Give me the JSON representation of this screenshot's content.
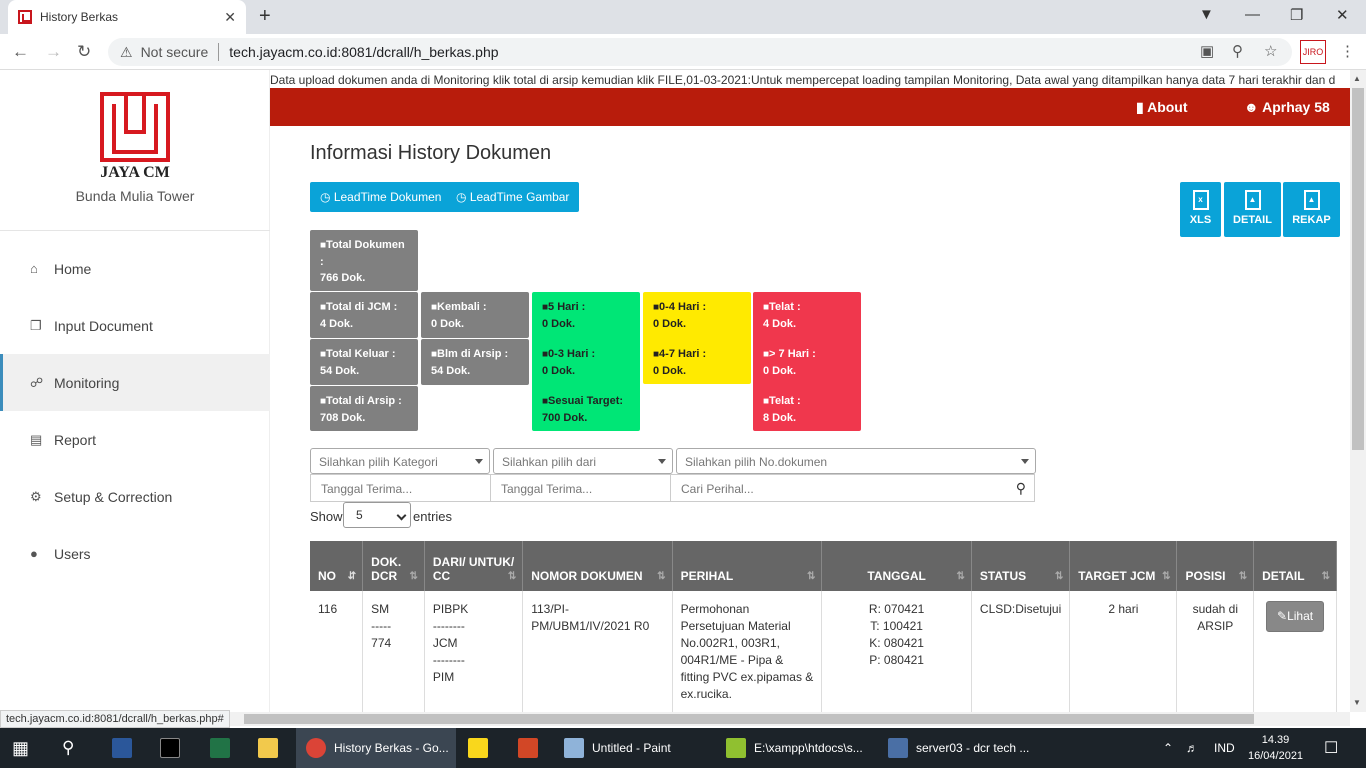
{
  "browser": {
    "tab_title": "History Berkas",
    "tab_close": "✕",
    "new_tab": "+",
    "not_secure": "Not secure",
    "url": "tech.jayacm.co.id:8081/dcrall/h_berkas.php",
    "status_url": "tech.jayacm.co.id:8081/dcrall/h_berkas.php#"
  },
  "sidebar": {
    "logo_text": "JAYA CM",
    "tower": "Bunda Mulia Tower",
    "items": [
      {
        "label": "Home",
        "icon": "home-icon"
      },
      {
        "label": "Input Document",
        "icon": "copy-icon"
      },
      {
        "label": "Monitoring",
        "icon": "binoculars-icon"
      },
      {
        "label": "Report",
        "icon": "file-icon"
      },
      {
        "label": "Setup & Correction",
        "icon": "gear-icon"
      },
      {
        "label": "Users",
        "icon": "users-icon"
      }
    ]
  },
  "marquee": "Data upload dokumen anda di Monitoring klik total di arsip kemudian klik FILE,01-03-2021:Untuk mempercepat loading tampilan Monitoring, Data awal yang ditampilkan hanya data 7 hari terakhir dan d",
  "topbar": {
    "about": "About",
    "user": "Aprhay 58"
  },
  "page": {
    "title": "Informasi History Dokumen",
    "btn_leadtime_doc": "LeadTime Dokumen",
    "btn_leadtime_gambar": "LeadTime Gambar",
    "export": {
      "xls": "XLS",
      "detail": "DETAIL",
      "rekap": "REKAP"
    }
  },
  "tiles": {
    "total_dok": {
      "label": "Total Dokumen :",
      "value": "766 Dok."
    },
    "total_jcm": {
      "label": "Total di JCM :",
      "value": "4 Dok."
    },
    "total_keluar": {
      "label": "Total Keluar :",
      "value": "54 Dok."
    },
    "total_arsip": {
      "label": "Total di Arsip :",
      "value": "708 Dok."
    },
    "kembali": {
      "label": "Kembali :",
      "value": "0 Dok."
    },
    "blm_arsip": {
      "label": "Blm di Arsip :",
      "value": "54 Dok."
    },
    "hari5": {
      "label": "5 Hari :",
      "value": "0 Dok."
    },
    "hari03": {
      "label": "0-3 Hari :",
      "value": "0 Dok."
    },
    "sesuai": {
      "label": "Sesuai Target:",
      "value": "700 Dok."
    },
    "hari04": {
      "label": "0-4 Hari :",
      "value": "0 Dok."
    },
    "hari47": {
      "label": "4-7 Hari :",
      "value": "0 Dok."
    },
    "telat1": {
      "label": "Telat :",
      "value": "4 Dok."
    },
    "lebih7": {
      "label": "> 7 Hari :",
      "value": "0 Dok."
    },
    "telat2": {
      "label": "Telat :",
      "value": "8 Dok."
    }
  },
  "filters": {
    "kategori": "Silahkan pilih Kategori",
    "dari": "Silahkan pilih dari",
    "nodok": "Silahkan pilih No.dokumen",
    "tgl1": "Tanggal Terima...",
    "tgl2": "Tanggal Terima...",
    "perihal": "Cari Perihal..."
  },
  "length": {
    "show": "Show",
    "value": "5",
    "entries": "entries"
  },
  "table": {
    "headers": [
      "NO",
      "DOK. DCR",
      "DARI/ UNTUK/ CC",
      "NOMOR DOKUMEN",
      "PERIHAL",
      "TANGGAL",
      "STATUS",
      "TARGET JCM",
      "POSISI",
      "DETAIL"
    ],
    "row": {
      "no": "116",
      "dcr1": "SM",
      "dcr2": "-----",
      "dcr3": "774",
      "dari1": "PIBPK",
      "dari2": "--------",
      "dari3": "JCM",
      "dari4": "--------",
      "dari5": "PIM",
      "nomor": "113/PI-PM/UBM1/IV/2021 R0",
      "perihal": "Permohonan Persetujuan Material No.002R1, 003R1, 004R1/ME - Pipa & fitting PVC ex.pipamas & ex.rucika.",
      "t1": "R: 070421",
      "t2": "T: 100421",
      "t3": "K: 080421",
      "t4": "P: 080421",
      "status": "CLSD:Disetujui",
      "target": "2 hari",
      "posisi": "sudah di ARSIP",
      "lihat": "✎Lihat"
    }
  },
  "taskbar": {
    "chrome": "History Berkas - Go...",
    "paint": "Untitled - Paint",
    "notepad": "E:\\xampp\\htdocs\\s...",
    "server": "server03 - dcr tech ...",
    "lang": "IND",
    "time": "14.39",
    "date": "16/04/2021"
  }
}
